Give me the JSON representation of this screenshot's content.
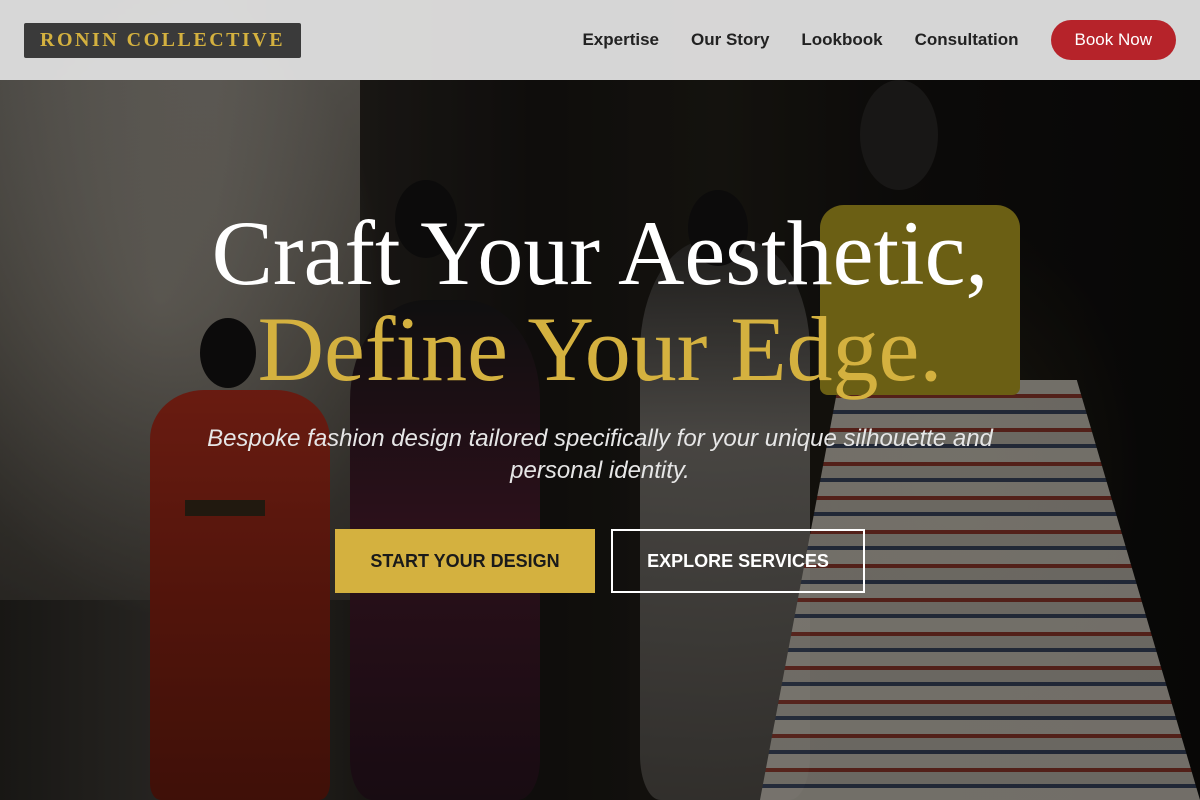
{
  "header": {
    "logo_text": "RONIN COLLECTIVE",
    "nav": [
      {
        "label": "Expertise"
      },
      {
        "label": "Our Story"
      },
      {
        "label": "Lookbook"
      },
      {
        "label": "Consultation"
      }
    ],
    "book_label": "Book Now"
  },
  "hero": {
    "headline_line1": "Craft Your Aesthetic,",
    "headline_line2": "Define Your Edge.",
    "subtitle": "Bespoke fashion design tailored specifically for your unique silhouette and personal identity.",
    "primary_cta": "START YOUR DESIGN",
    "secondary_cta": "EXPLORE SERVICES",
    "background_image": "fashion-exhibit-mannequins-photo"
  },
  "colors": {
    "accent_gold": "#d4b13f",
    "cta_red": "#b6232a",
    "header_bg": "#e1e1e1",
    "logo_bg": "#3a3a3a"
  }
}
